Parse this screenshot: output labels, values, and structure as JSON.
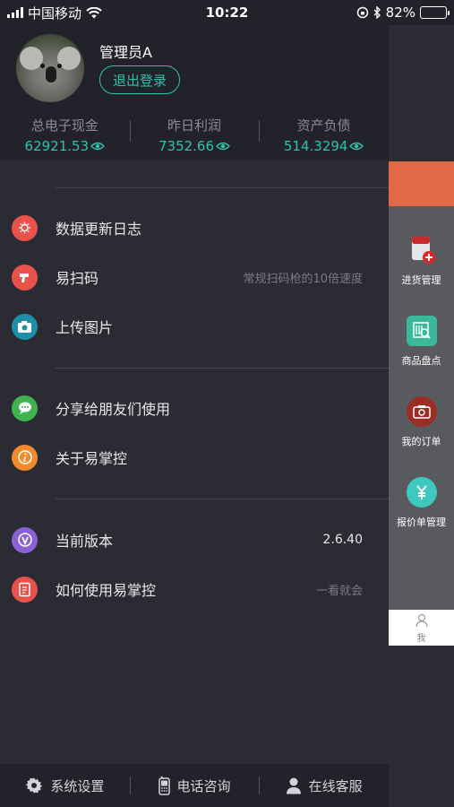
{
  "status_bar": {
    "carrier": "中国移动",
    "time": "10:22",
    "battery": "82%",
    "battery_level": 0.82
  },
  "profile": {
    "username": "管理员A",
    "logout_label": "退出登录"
  },
  "stats": [
    {
      "label": "总电子现金",
      "value": "62921.53"
    },
    {
      "label": "昨日利润",
      "value": "7352.66"
    },
    {
      "label": "资产负债",
      "value": "514.3294"
    }
  ],
  "menu": [
    {
      "label": "数据更新日志",
      "right": "",
      "icon": "bulb-icon",
      "color": "#e8524a"
    },
    {
      "label": "易扫码",
      "right": "常规扫码枪的10倍速度",
      "icon": "scanner-icon",
      "color": "#e8524a"
    },
    {
      "label": "上传图片",
      "right": "",
      "icon": "camera-icon",
      "color": "#1e8fa8"
    },
    {
      "label": "分享给朋友们使用",
      "right": "",
      "icon": "chat-icon",
      "color": "#3fb34f"
    },
    {
      "label": "关于易掌控",
      "right": "",
      "icon": "info-icon",
      "color": "#f08a2a"
    },
    {
      "label": "当前版本",
      "right": "2.6.40",
      "icon": "version-icon",
      "color": "#8a62d6"
    },
    {
      "label": "如何使用易掌控",
      "right": "一看就会",
      "icon": "document-icon",
      "color": "#e8524a"
    }
  ],
  "bottom_bar": [
    {
      "label": "系统设置",
      "icon": "gear-icon"
    },
    {
      "label": "电话咨询",
      "icon": "phone-icon"
    },
    {
      "label": "在线客服",
      "icon": "person-icon"
    }
  ],
  "side_panel": {
    "items": [
      {
        "label": "进货管理",
        "icon": "purchase-icon"
      },
      {
        "label": "商品盘点",
        "icon": "inventory-icon"
      },
      {
        "label": "我的订单",
        "icon": "order-icon"
      },
      {
        "label": "报价单管理",
        "icon": "quote-icon"
      }
    ],
    "me_label": "我"
  }
}
